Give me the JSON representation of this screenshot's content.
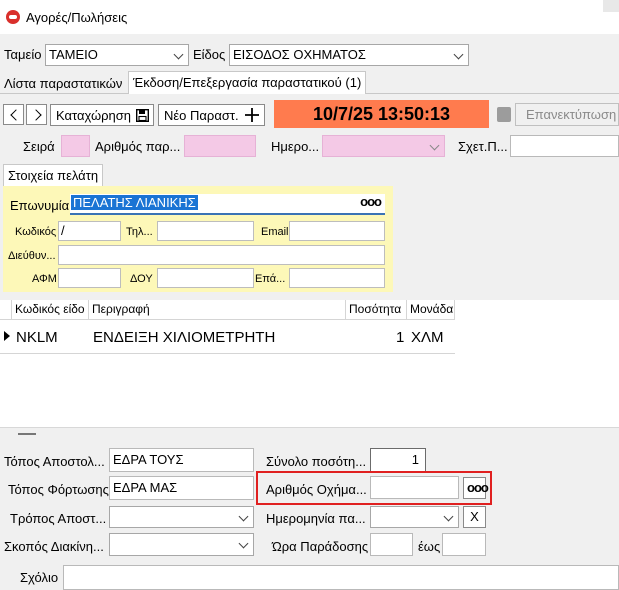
{
  "window": {
    "title": "Αγορές/Πωλήσεις"
  },
  "top": {
    "tameio_label": "Ταμείο",
    "tameio_value": "ΤΑΜΕΙΟ",
    "eidos_label": "Είδος",
    "eidos_value": "ΕΙΣΟΔΟΣ ΟΧΗΜΑΤΟΣ"
  },
  "tabs": [
    {
      "label": "Λίστα παραστατικών"
    },
    {
      "label": "Έκδοση/Επεξεργασία παραστατικού (1)"
    }
  ],
  "toolbar": {
    "save_label": "Καταχώρηση",
    "new_label": "Νέο Παραστ.",
    "datetime": "10/7/25 13:50:13",
    "reprint_label": "Επανεκτύπωση"
  },
  "doc": {
    "seira_label": "Σειρά",
    "arithmos_label": "Αριθμός παρ...",
    "imero_label": "Ημερο...",
    "sxet_label": "Σχετ.Π..."
  },
  "customer": {
    "tab_label": "Στοιχεία πελάτη",
    "eponymia_label": "Επωνυμία",
    "eponymia_value": "ΠΕΛΑΤΗΣ ΛΙΑΝΙΚΗΣ",
    "kodikos_label": "Κωδικός",
    "kodikos_value": "/",
    "til_label": "Τηλ...",
    "email_label": "Email",
    "dieuth_label": "Διεύθυν...",
    "afm_label": "ΑΦΜ",
    "doy_label": "ΔΟΥ",
    "epag_label": "Επά..."
  },
  "grid": {
    "headers": [
      "Κωδικός είδο",
      "Περιγραφή",
      "Ποσότητα",
      "Μονάδα"
    ],
    "rows": [
      {
        "code": "NKLM",
        "desc": "ΕΝΔΕΙΞΗ ΧΙΛΙΟΜΕΤΡΗΤΗ",
        "qty": "1",
        "unit": "ΧΛΜ"
      }
    ]
  },
  "bottom": {
    "topos_apostolis_label": "Τόπος Αποστολ...",
    "topos_apostolis_value": "ΕΔΡΑ ΤΟΥΣ",
    "topos_fortosis_label": "Τόπος Φόρτωσης",
    "topos_fortosis_value": "ΕΔΡΑ ΜΑΣ",
    "tropos_label": "Τρόπος Αποστ...",
    "skopos_label": "Σκοπός Διακίνη...",
    "synolo_label": "Σύνολο ποσότη...",
    "synolo_value": "1",
    "arithmos_oximatos_label": "Αριθμός Οχήμα...",
    "imerominia_label": "Ημερομηνία πα...",
    "clear_label": "X",
    "ora_label": "Ώρα Παράδοσης",
    "eos_label": "έως",
    "sxolio_label": "Σχόλιο"
  },
  "colors": {
    "datetime_bg": "#ff7b4e",
    "highlight_border": "#e02020",
    "customer_bg": "#fdf8b8",
    "required_pink": "#f4c9e6"
  }
}
